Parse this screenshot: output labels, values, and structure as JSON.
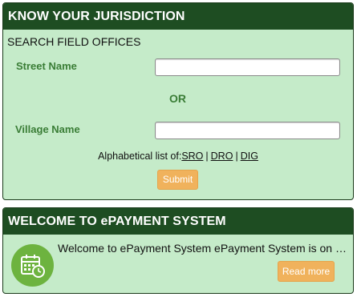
{
  "jurisdiction": {
    "title": "KNOW YOUR JURISDICTION",
    "section_label": "SEARCH FIELD OFFICES",
    "street_label": "Street Name",
    "street_value": "",
    "or_label": "OR",
    "village_label": "Village Name",
    "village_value": "",
    "alpha_prefix": "Alphabetical list of:",
    "alpha_links": [
      "SRO",
      "DRO",
      "DIG"
    ],
    "separator": "|",
    "submit_label": "Submit"
  },
  "epayment": {
    "title": "WELCOME TO ePAYMENT SYSTEM",
    "icon": "calendar-clock-icon",
    "text": "Welcome to ePayment System ePayment System is on the way to make every payment online",
    "read_more_label": "Read more"
  },
  "colors": {
    "header_bg": "#1e4d22",
    "panel_bg": "#c5ebc9",
    "label_green": "#3a7d36",
    "button_orange": "#f0b25c",
    "icon_circle": "#6db33f"
  }
}
